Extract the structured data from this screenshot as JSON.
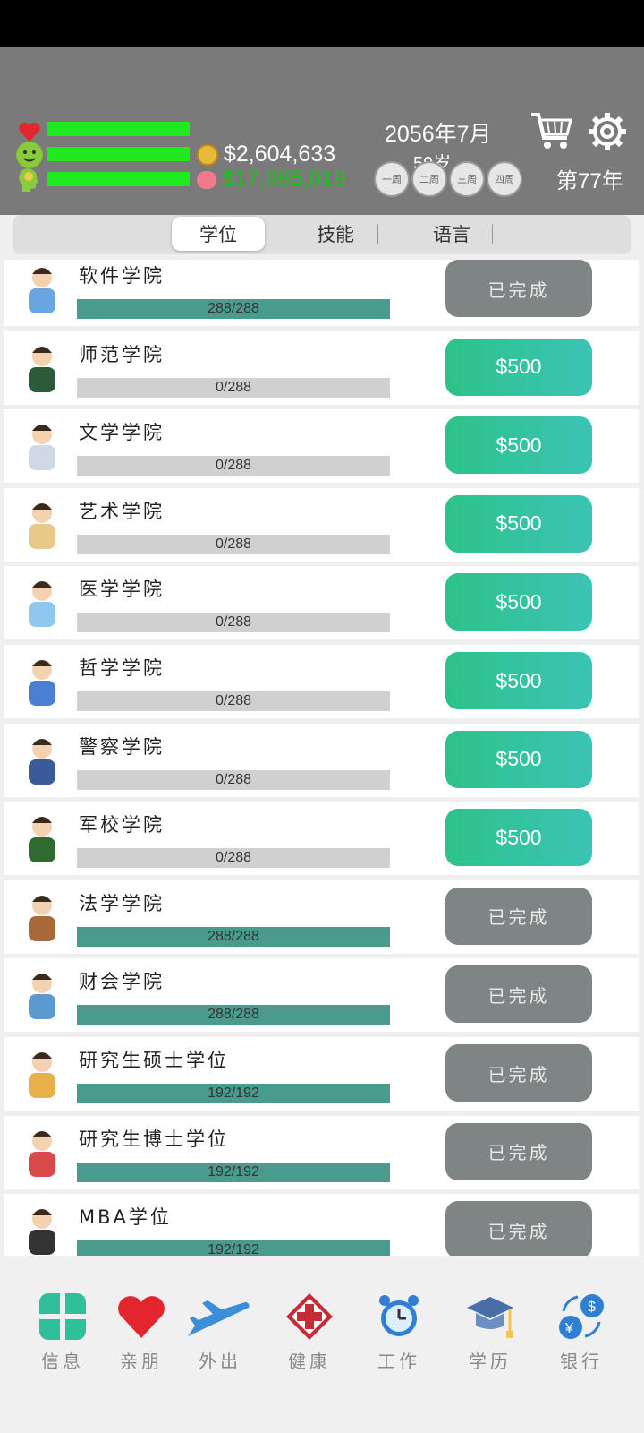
{
  "header": {
    "money": "$2,604,633",
    "savings": "$17,965,019",
    "date_line": "2056年7月",
    "age_line": "59岁",
    "weeks": [
      "一周",
      "二周",
      "三周",
      "四周"
    ],
    "year_label": "第77年",
    "colors": {
      "bar": "#1eea1e",
      "savings": "#19c419"
    }
  },
  "tabs": [
    {
      "label": "学位",
      "active": true
    },
    {
      "label": "技能",
      "active": false
    },
    {
      "label": "语言",
      "active": false
    }
  ],
  "degrees": [
    {
      "title": "软件学院",
      "progress": "288/288",
      "ratio": 1,
      "action": "已完成",
      "state": "done",
      "icon": "software-student-icon"
    },
    {
      "title": "师范学院",
      "progress": "0/288",
      "ratio": 0,
      "action": "$500",
      "state": "buy",
      "icon": "teacher-icon"
    },
    {
      "title": "文学学院",
      "progress": "0/288",
      "ratio": 0,
      "action": "$500",
      "state": "buy",
      "icon": "poet-icon"
    },
    {
      "title": "艺术学院",
      "progress": "0/288",
      "ratio": 0,
      "action": "$500",
      "state": "buy",
      "icon": "painter-icon"
    },
    {
      "title": "医学学院",
      "progress": "0/288",
      "ratio": 0,
      "action": "$500",
      "state": "buy",
      "icon": "doctor-icon"
    },
    {
      "title": "哲学学院",
      "progress": "0/288",
      "ratio": 0,
      "action": "$500",
      "state": "buy",
      "icon": "philosophy-icon"
    },
    {
      "title": "警察学院",
      "progress": "0/288",
      "ratio": 0,
      "action": "$500",
      "state": "buy",
      "icon": "police-icon"
    },
    {
      "title": "军校学院",
      "progress": "0/288",
      "ratio": 0,
      "action": "$500",
      "state": "buy",
      "icon": "soldier-icon"
    },
    {
      "title": "法学学院",
      "progress": "288/288",
      "ratio": 1,
      "action": "已完成",
      "state": "done",
      "icon": "lawyer-icon"
    },
    {
      "title": "财会学院",
      "progress": "288/288",
      "ratio": 1,
      "action": "已完成",
      "state": "done",
      "icon": "accountant-icon"
    },
    {
      "title": "研究生硕士学位",
      "progress": "192/192",
      "ratio": 1,
      "action": "已完成",
      "state": "done",
      "icon": "masters-grad-icon"
    },
    {
      "title": "研究生博士学位",
      "progress": "192/192",
      "ratio": 1,
      "action": "已完成",
      "state": "done",
      "icon": "doctorate-grad-icon"
    },
    {
      "title": "MBA学位",
      "progress": "192/192",
      "ratio": 1,
      "action": "已完成",
      "state": "done",
      "icon": "mba-businessman-icon"
    }
  ],
  "nav": [
    {
      "label": "信息",
      "icon": "info-grid-icon"
    },
    {
      "label": "亲朋",
      "icon": "heart-icon"
    },
    {
      "label": "外出",
      "icon": "airplane-icon"
    },
    {
      "label": "健康",
      "icon": "medical-cross-icon"
    },
    {
      "label": "工作",
      "icon": "alarm-clock-icon"
    },
    {
      "label": "学历",
      "icon": "graduation-cap-icon"
    },
    {
      "label": "银行",
      "icon": "currency-exchange-icon"
    }
  ]
}
